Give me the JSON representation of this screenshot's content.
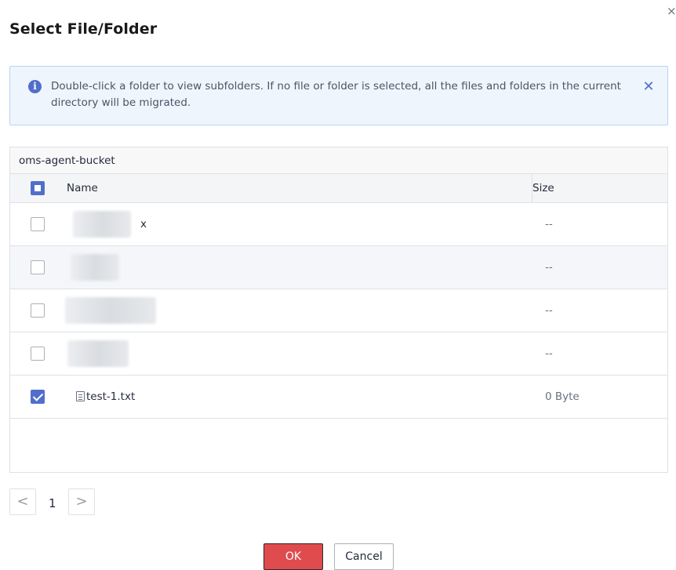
{
  "dialog": {
    "title": "Select File/Folder",
    "close_glyph": "×"
  },
  "info": {
    "icon": "info-icon",
    "icon_glyph": "i",
    "text": "Double-click a folder to view subfolders. If no file or folder is selected, all the files and folders in the current directory will be migrated.",
    "close_glyph": "✕"
  },
  "table": {
    "bucket": "oms-agent-bucket",
    "columns": {
      "name": "Name",
      "size": "Size"
    },
    "rows": [
      {
        "name": "x",
        "size": "--",
        "checked": false
      },
      {
        "name": "",
        "size": "--",
        "checked": false
      },
      {
        "name": "",
        "size": "--",
        "checked": false
      },
      {
        "name": "",
        "size": "--",
        "checked": false
      },
      {
        "name": "test-1.txt",
        "size": "0 Byte",
        "checked": true
      }
    ]
  },
  "pager": {
    "prev": "<",
    "page": "1",
    "next": ">"
  },
  "buttons": {
    "ok": "OK",
    "cancel": "Cancel"
  },
  "colors": {
    "primary": "#526ecc",
    "danger": "#e04b4e",
    "info_bg": "#eef5fd"
  }
}
